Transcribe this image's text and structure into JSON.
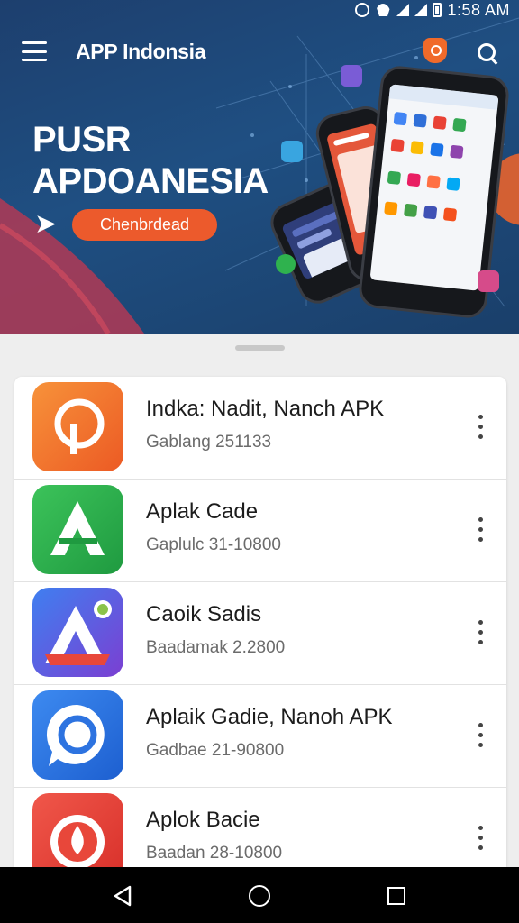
{
  "status_bar": {
    "time": "1:58 AM"
  },
  "appbar": {
    "title": "APP Indonsia"
  },
  "hero": {
    "title_line1": "PUSR",
    "title_line2": "APDOANESIA",
    "download_label": "Chenbrdead"
  },
  "apps": [
    {
      "name": "Indka: Nadit, Nanch APK",
      "meta": "Gablang 251133",
      "color": "#f06b2c"
    },
    {
      "name": "Aplak Cade",
      "meta": "Gaplulc 31-10800",
      "color": "#2fb24e"
    },
    {
      "name": "Caoik Sadis",
      "meta": "Baadamak 2.2800",
      "color": "#3b64d8"
    },
    {
      "name": "Aplaik Gadie, Nanoh APK",
      "meta": "Gadbae 21-90800",
      "color": "#2d73e0"
    },
    {
      "name": "Aplok Bacie",
      "meta": "Baadan 28-10800",
      "color": "#e8473a"
    }
  ],
  "icons": {
    "menu": "menu-icon",
    "notification": "notification-icon",
    "search": "search-icon",
    "more": "more-vert-icon",
    "back": "nav-back-icon",
    "home": "nav-home-icon",
    "recent": "nav-recent-icon"
  }
}
